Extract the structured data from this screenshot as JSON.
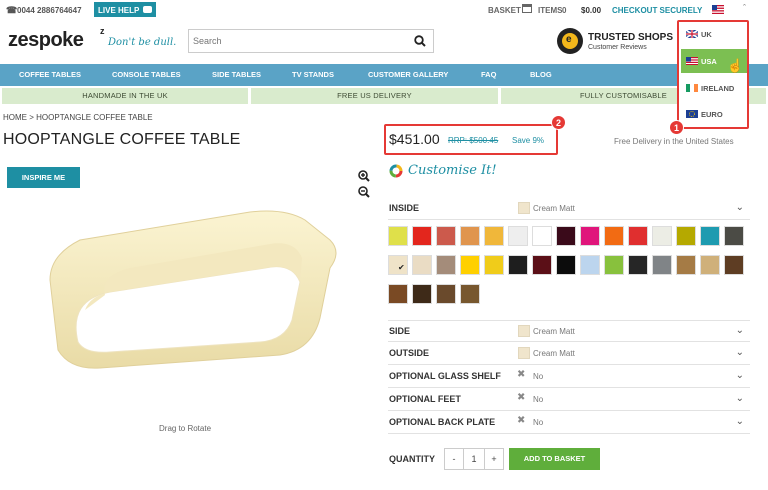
{
  "topbar": {
    "phone": "0044 2886764647",
    "live_help": "LIVE HELP",
    "basket_label": "BASKET",
    "items_label": "ITEMS",
    "items_count": "0",
    "total": "$0.00",
    "checkout": "CHECKOUT SECURELY"
  },
  "header": {
    "logo": "zespoke",
    "logo_sup": "z",
    "tagline": "Don't be dull.",
    "search_placeholder": "Search",
    "trusted_title": "TRUSTED SHOPS",
    "trusted_sub": "Customer Reviews"
  },
  "currency_menu": {
    "items": [
      {
        "label": "UK",
        "flag": "uk"
      },
      {
        "label": "USA",
        "flag": "usa"
      },
      {
        "label": "IRELAND",
        "flag": "ireland"
      },
      {
        "label": "EURO",
        "flag": "euro"
      }
    ],
    "selected": "USA"
  },
  "nav": [
    "COFFEE TABLES",
    "CONSOLE TABLES",
    "SIDE TABLES",
    "TV STANDS",
    "CUSTOMER GALLERY",
    "FAQ",
    "BLOG"
  ],
  "usp": [
    "HANDMADE IN THE UK",
    "FREE US DELIVERY",
    "FULLY CUSTOMISABLE"
  ],
  "breadcrumb": {
    "home": "HOME",
    "sep": ">",
    "current": "HOOPTANGLE COFFEE TABLE"
  },
  "product": {
    "title": "HOOPTANGLE COFFEE TABLE",
    "inspire": "INSPIRE ME",
    "drag_hint": "Drag to Rotate",
    "price": "$451.00",
    "rrp": "RRP: $500.45",
    "save": "Save 9%",
    "delivery": "Free Delivery in the United States",
    "customise": "Customise It!"
  },
  "options": {
    "inside": {
      "label": "INSIDE",
      "value": "Cream Matt"
    },
    "side": {
      "label": "SIDE",
      "value": "Cream Matt"
    },
    "outside": {
      "label": "OUTSIDE",
      "value": "Cream Matt"
    },
    "glass": {
      "label": "OPTIONAL GLASS SHELF",
      "value": "No"
    },
    "feet": {
      "label": "OPTIONAL FEET",
      "value": "No"
    },
    "back": {
      "label": "OPTIONAL BACK PLATE",
      "value": "No"
    }
  },
  "quantity": {
    "label": "QUANTITY",
    "minus": "-",
    "value": "1",
    "plus": "+",
    "add": "ADD TO BASKET"
  },
  "annotations": {
    "badge1": "1",
    "badge2": "2"
  },
  "swatches": [
    "#dfe04a",
    "#e3261d",
    "#cc5a4c",
    "#e0954e",
    "#f0b73a",
    "#eeeeee",
    "#ffffff",
    "#3a0a1a",
    "#e0157b",
    "#f26b13",
    "#e02f2f",
    "#ecede5",
    "#b5a900",
    "#1e9bb0",
    "#4b4b45",
    "#efe3c8",
    "#eadcc4",
    "#a48c7a",
    "#ffd000",
    "#f0cc1a",
    "#1e1e1e",
    "#5b0f17",
    "#0c0c0c",
    "#bcd5ee",
    "#88c13d",
    "#262626",
    "#808487",
    "#a57b45",
    "#cfb07a",
    "#5e3d23",
    "#7a4a24",
    "#3e2a18",
    "#6a4a2c",
    "#77572e"
  ],
  "colors": {
    "nav": "#5aa3c6",
    "usp": "#d9ebcd",
    "green": "#5fae3b",
    "teal": "#1e8fa3",
    "red": "#e53935"
  }
}
